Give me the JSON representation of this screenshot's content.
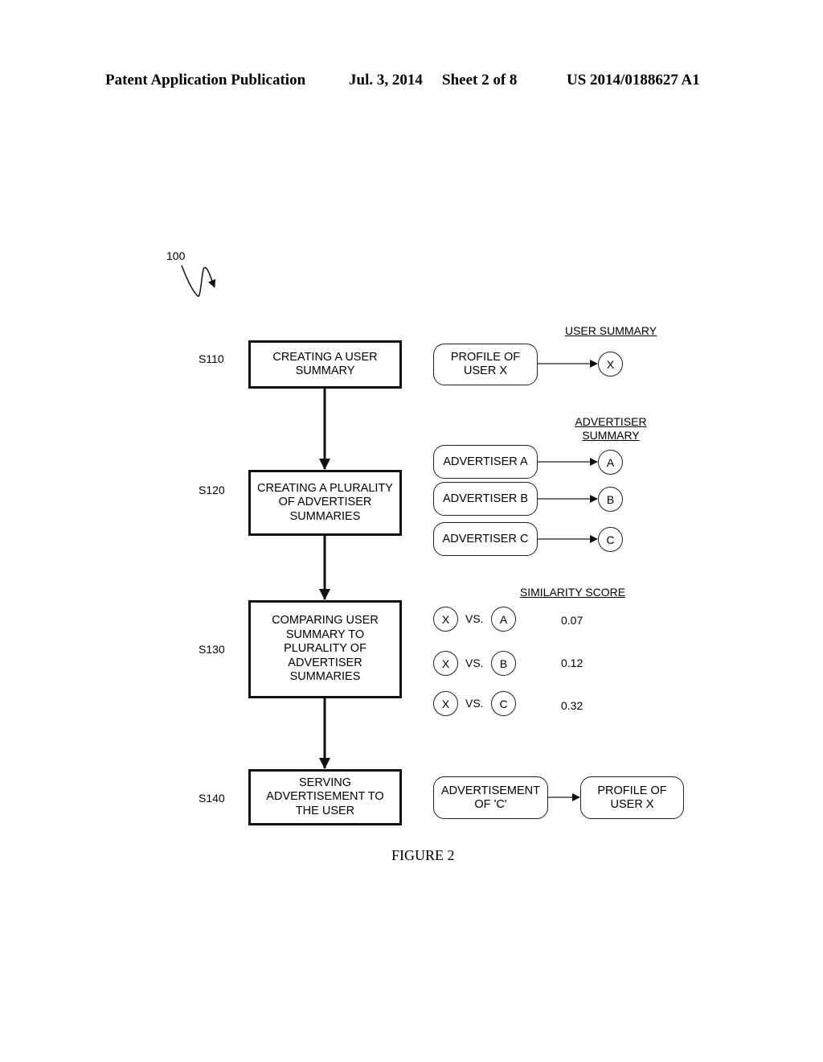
{
  "header": {
    "publication": "Patent Application Publication",
    "date": "Jul. 3, 2014",
    "sheet": "Sheet 2 of 8",
    "number": "US 2014/0188627 A1"
  },
  "reference": "100",
  "steps": [
    {
      "id": "S110",
      "text": "CREATING A USER SUMMARY"
    },
    {
      "id": "S120",
      "text": "CREATING A PLURALITY OF ADVERTISER SUMMARIES"
    },
    {
      "id": "S130",
      "text": "COMPARING USER SUMMARY TO PLURALITY OF ADVERTISER SUMMARIES"
    },
    {
      "id": "S140",
      "text": "SERVING ADVERTISEMENT TO THE USER"
    }
  ],
  "user_summary": {
    "heading": "USER SUMMARY",
    "source": "PROFILE OF USER X",
    "symbol": "X"
  },
  "advertiser_summary": {
    "heading_line1": "ADVERTISER",
    "heading_line2": "SUMMARY",
    "items": [
      {
        "source": "ADVERTISER A",
        "symbol": "A"
      },
      {
        "source": "ADVERTISER B",
        "symbol": "B"
      },
      {
        "source": "ADVERTISER C",
        "symbol": "C"
      }
    ]
  },
  "similarity": {
    "heading": "SIMILARITY SCORE",
    "vs_label": "VS.",
    "rows": [
      {
        "left": "X",
        "right": "A",
        "score": "0.07"
      },
      {
        "left": "X",
        "right": "B",
        "score": "0.12"
      },
      {
        "left": "X",
        "right": "C",
        "score": "0.32"
      }
    ]
  },
  "serving": {
    "ad": "ADVERTISEMENT OF 'C'",
    "target": "PROFILE OF USER X"
  },
  "caption": "FIGURE 2"
}
